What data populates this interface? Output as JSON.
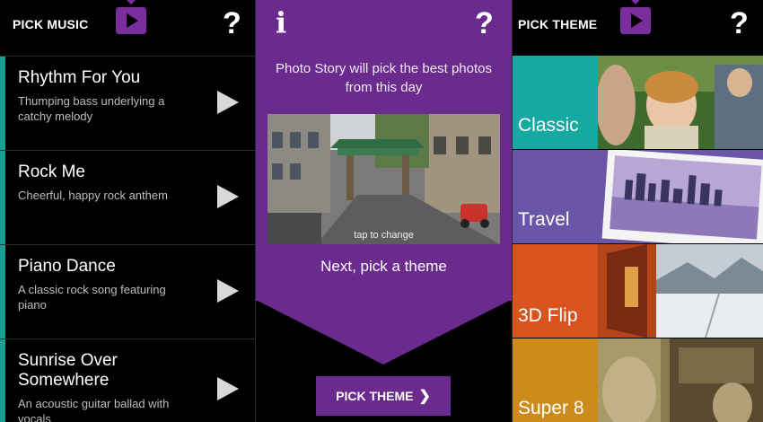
{
  "left": {
    "title": "PICK MUSIC",
    "help": "?",
    "songs": [
      {
        "name": "Rhythm For You",
        "desc": "Thumping bass underlying a catchy melody",
        "selected": true
      },
      {
        "name": "Rock Me",
        "desc": "Cheerful, happy rock anthem",
        "selected": false
      },
      {
        "name": "Piano Dance",
        "desc": "A classic rock song featuring piano",
        "selected": false
      },
      {
        "name": "Sunrise Over Somewhere",
        "desc": "An acoustic guitar ballad with vocals",
        "selected": false
      }
    ]
  },
  "mid": {
    "info": "i",
    "help": "?",
    "message": "Photo Story will pick the best photos from this day",
    "photo_caption": "tap to change",
    "next_text": "Next, pick a theme",
    "button_label": "PICK THEME",
    "button_chevron": "❯"
  },
  "right": {
    "title": "PICK THEME",
    "help": "?",
    "themes": [
      {
        "name": "Classic",
        "color": "#15a9a1"
      },
      {
        "name": "Travel",
        "color": "#6b55a8"
      },
      {
        "name": "3D Flip",
        "color": "#d9531e"
      },
      {
        "name": "Super 8",
        "color": "#cf8a1c"
      }
    ]
  },
  "colors": {
    "accent": "#1aa095",
    "brand_purple": "#6a2a8e"
  }
}
